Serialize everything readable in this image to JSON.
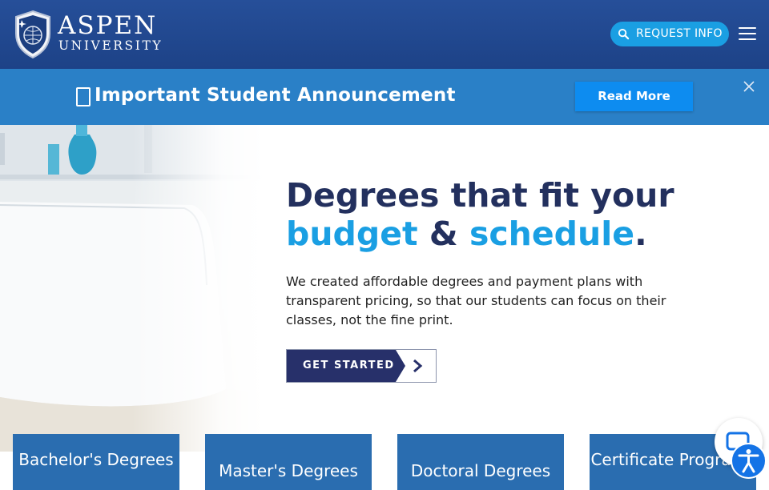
{
  "header": {
    "logo_word": "ASPEN",
    "logo_sub": "UNIVERSITY",
    "request_info_label": "REQUEST INFO"
  },
  "announcement": {
    "text": "Important Student Announcement",
    "read_more_label": "Read More"
  },
  "hero": {
    "headline_part1": "Degrees that fit your",
    "headline_highlight1": "budget",
    "headline_amp": "&",
    "headline_highlight2": "schedule",
    "headline_period": ".",
    "paragraph": "We created affordable degrees and payment plans with transparent pricing, so that our students can focus on their classes, not the fine print.",
    "cta_label": "GET STARTED"
  },
  "cards": [
    {
      "label": "Bachelor's Degrees"
    },
    {
      "label": "Master's Degrees"
    },
    {
      "label": "Doctoral Degrees"
    },
    {
      "label": "Certificate Programs"
    }
  ],
  "colors": {
    "header_blue": "#1d4287",
    "announcement_blue": "#2a80c7",
    "accent_cyan": "#1a9fe3",
    "navy_text": "#23305e",
    "card_blue": "#2a6db0"
  },
  "icons": {
    "search": "search-icon",
    "menu": "hamburger-menu-icon",
    "close": "close-icon",
    "chevron": "chevron-right-icon",
    "chat": "chat-icon",
    "accessibility": "accessibility-icon"
  }
}
